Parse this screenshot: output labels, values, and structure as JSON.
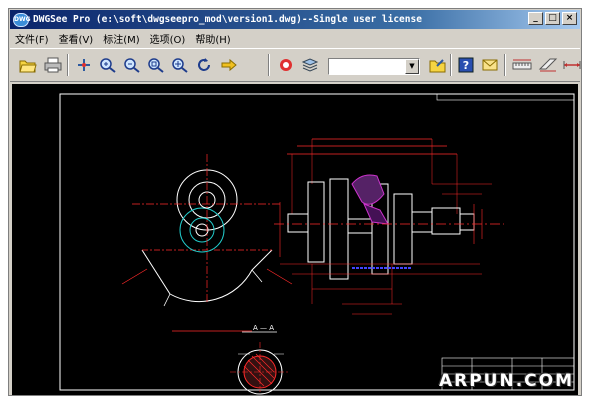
{
  "window": {
    "title": "DWGSee Pro (e:\\soft\\dwgseepro_mod\\version1.dwg)--Single user license",
    "app_icon_text": "DWG",
    "minimize": "_",
    "maximize": "□",
    "close": "×"
  },
  "menu": [
    {
      "label": "文件(F)"
    },
    {
      "label": "查看(V)"
    },
    {
      "label": "标注(M)"
    },
    {
      "label": "选项(O)"
    },
    {
      "label": "帮助(H)"
    }
  ],
  "toolbar": {
    "icons": [
      "open-folder-icon",
      "print-icon",
      "pan-icon",
      "zoom-in-icon",
      "zoom-out-icon",
      "zoom-window-icon",
      "zoom-all-icon",
      "rotate-icon",
      "next-arrow-icon",
      "layers-icon",
      "stack-icon",
      "folder-icon",
      "help-icon",
      "mail-icon",
      "measure-icon",
      "ruler-icon",
      "dimension-icon"
    ],
    "combo_value": ""
  },
  "drawing": {
    "section_label": "A — A",
    "watermark": "ARPUN.COM",
    "colors": {
      "background": "#000000",
      "lines": "#ff2a2a",
      "white": "#ffffff",
      "magenta": "#cc33cc",
      "blue": "#4444ff",
      "cyan": "#22cccc"
    }
  }
}
